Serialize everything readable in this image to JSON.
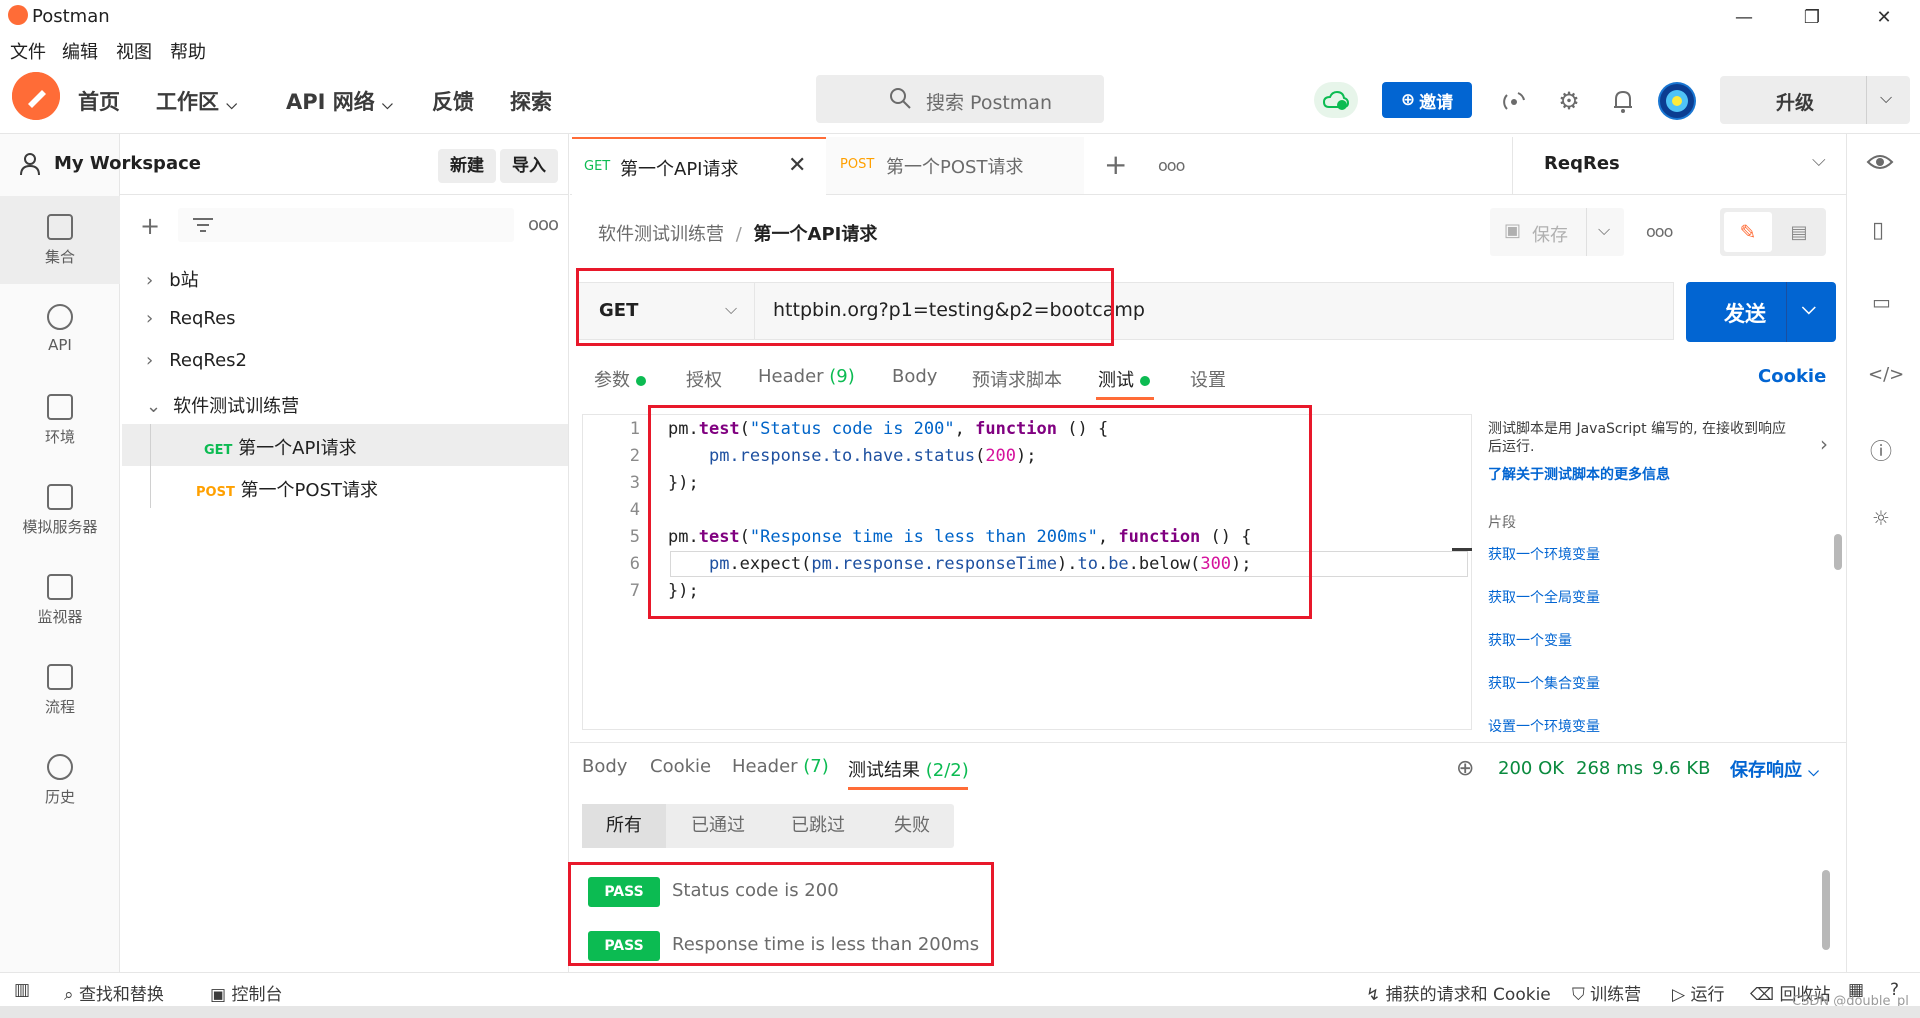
{
  "window": {
    "title": "Postman",
    "minimize": "—",
    "maximize": "❐",
    "close": "✕"
  },
  "menubar": [
    "文件",
    "编辑",
    "视图",
    "帮助"
  ],
  "header": {
    "home": "首页",
    "workspaces": "工作区",
    "api_network": "API 网络",
    "feedback": "反馈",
    "explore": "探索",
    "search_placeholder": "搜索 Postman",
    "invite": "邀请",
    "upgrade": "升级"
  },
  "rail": {
    "collections": "集合",
    "api": "API",
    "environments": "环境",
    "mock_servers": "模拟服务器",
    "monitors": "监视器",
    "flows": "流程",
    "history": "历史"
  },
  "sidebar": {
    "workspace_name": "My Workspace",
    "new_btn": "新建",
    "import_btn": "导入",
    "items": [
      {
        "label": "b站"
      },
      {
        "label": "ReqRes"
      },
      {
        "label": "ReqRes2"
      },
      {
        "label": "软件测试训练营"
      }
    ],
    "children": [
      {
        "method": "GET",
        "label": "第一个API请求"
      },
      {
        "method": "POST",
        "label": "第一个POST请求"
      }
    ]
  },
  "tabs": [
    {
      "method": "GET",
      "label": "第一个API请求"
    },
    {
      "method": "POST",
      "label": "第一个POST请求"
    }
  ],
  "environment": "ReqRes",
  "breadcrumb": {
    "parent": "软件测试训练营",
    "separator": "/",
    "current": "第一个API请求"
  },
  "save_label": "保存",
  "request": {
    "method": "GET",
    "url": "httpbin.org?p1=testing&p2=bootcamp",
    "send": "发送"
  },
  "request_tabs": {
    "params": "参数",
    "auth": "授权",
    "headers": "Header",
    "headers_count": "(9)",
    "body": "Body",
    "prerequest": "预请求脚本",
    "tests": "测试",
    "settings": "设置",
    "cookies": "Cookie"
  },
  "code": {
    "line_numbers": [
      "1",
      "2",
      "3",
      "4",
      "5",
      "6",
      "7"
    ]
  },
  "help": {
    "description": "测试脚本是用 JavaScript 编写的, 在接收到响应后运行.",
    "learn_more": "了解关于测试脚本的更多信息",
    "snippets_title": "片段",
    "snippets": [
      "获取一个环境变量",
      "获取一个全局变量",
      "获取一个变量",
      "获取一个集合变量",
      "设置一个环境变量"
    ]
  },
  "response": {
    "tabs": {
      "body": "Body",
      "cookie": "Cookie",
      "header": "Header",
      "header_count": "(7)",
      "results": "测试结果",
      "results_count": "(2/2)"
    },
    "status": "200 OK",
    "time": "268 ms",
    "size": "9.6 KB",
    "save_response": "保存响应",
    "filters": [
      "所有",
      "已通过",
      "已跳过",
      "失败"
    ],
    "results": [
      {
        "status": "PASS",
        "name": "Status code is 200"
      },
      {
        "status": "PASS",
        "name": "Response time is less than 200ms"
      }
    ]
  },
  "statusbar": {
    "find_replace": "查找和替换",
    "console": "控制台",
    "capture": "捕获的请求和 Cookie",
    "bootcamp": "训练营",
    "runner": "运行",
    "trash": "回收站",
    "watermark": "CSDN @double_pl"
  },
  "colors": {
    "brand": "#ff6c37",
    "primary": "#0265d2",
    "pass": "#0cbb52",
    "highlight": "#e8182a"
  }
}
